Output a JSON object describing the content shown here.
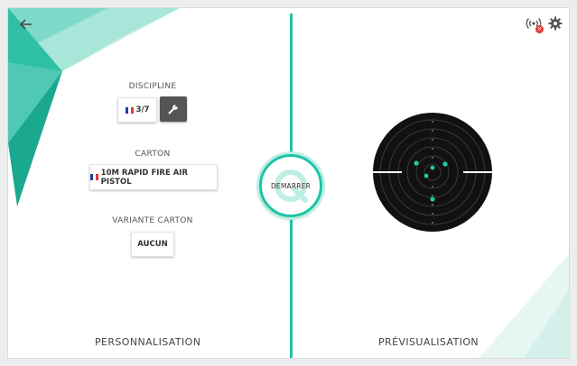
{
  "left_panel": {
    "discipline_label": "DISCIPLINE",
    "discipline_value": "3/7",
    "carton_label": "CARTON",
    "carton_value": "10M RAPID FIRE AIR PISTOL",
    "variante_label": "VARIANTE CARTON",
    "variante_value": "AUCUN",
    "footer": "PERSONNALISATION"
  },
  "center": {
    "start_label": "DEMARRER"
  },
  "right_panel": {
    "footer": "PRÉVISUALISATION"
  },
  "icons": {
    "back": "arrow-left-icon",
    "connection": "wifi-tethering-icon",
    "settings": "gear-icon"
  },
  "colors": {
    "accent": "#1ec4a6",
    "target": "#111111",
    "dark_button": "#555555"
  }
}
